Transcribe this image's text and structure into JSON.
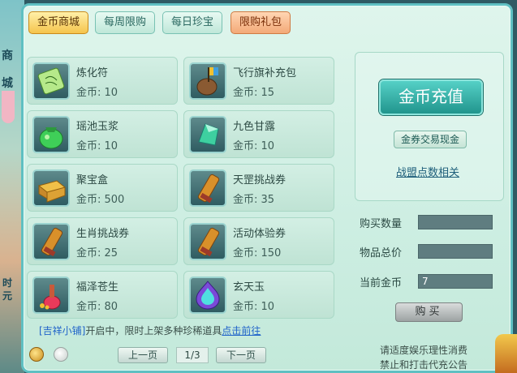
{
  "side": {
    "glyph1": "商",
    "glyph2": "城",
    "glyph3": "时",
    "glyph4": "元"
  },
  "tabs": [
    {
      "label": "金币商城"
    },
    {
      "label": "每周限购"
    },
    {
      "label": "每日珍宝"
    },
    {
      "label": "限购礼包"
    }
  ],
  "items": [
    {
      "name": "炼化符",
      "price": "金币: 10",
      "icon": "talisman-icon"
    },
    {
      "name": "飞行旗补充包",
      "price": "金币: 15",
      "icon": "flag-pouch-icon"
    },
    {
      "name": "瑶池玉浆",
      "price": "金币: 10",
      "icon": "jade-pouch-icon"
    },
    {
      "name": "九色甘露",
      "price": "金币: 10",
      "icon": "crystal-icon"
    },
    {
      "name": "聚宝盒",
      "price": "金币: 500",
      "icon": "treasure-box-icon"
    },
    {
      "name": "天罡挑战券",
      "price": "金币: 35",
      "icon": "scroll-icon"
    },
    {
      "name": "生肖挑战券",
      "price": "金币: 25",
      "icon": "scroll-icon"
    },
    {
      "name": "活动体验券",
      "price": "金币: 150",
      "icon": "scroll-icon"
    },
    {
      "name": "福泽苍生",
      "price": "金币: 80",
      "icon": "gourd-icon"
    },
    {
      "name": "玄天玉",
      "price": "金币: 10",
      "icon": "gem-icon"
    }
  ],
  "notice": {
    "shop": "[吉祥小铺]",
    "text": "开启中，限时上架多种珍稀道具",
    "link": "点击前往"
  },
  "pager": {
    "prev": "上一页",
    "page": "1/3",
    "next": "下一页"
  },
  "right": {
    "recharge": "金币充值",
    "exchange": "金券交易现金",
    "alliance": "战盟点数相关",
    "qty_label": "购买数量",
    "total_label": "物品总价",
    "gold_label": "当前金币",
    "qty_value": "",
    "total_value": "",
    "gold_value": "7",
    "buy": "购买"
  },
  "footer": {
    "line1": "请适度娱乐理性消费",
    "line2": "禁止和打击代充公告"
  }
}
